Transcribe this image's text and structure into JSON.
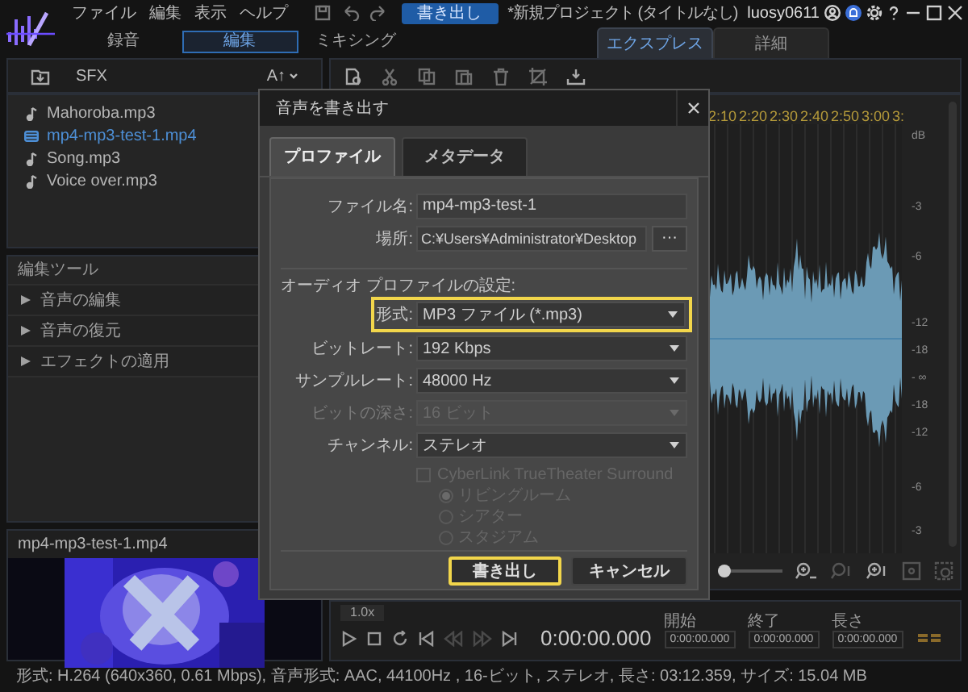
{
  "app": {
    "menu": [
      "ファイル",
      "編集",
      "表示",
      "ヘルプ"
    ],
    "export_button": "書き出し",
    "project_title": "*新規プロジェクト (タイトルなし)",
    "user": "luosy0611"
  },
  "mode_tabs": [
    {
      "label": "録音",
      "selected": false
    },
    {
      "label": "編集",
      "selected": true
    },
    {
      "label": "ミキシング",
      "selected": false
    }
  ],
  "view_tabs": [
    {
      "label": "エクスプレス",
      "selected": true
    },
    {
      "label": "詳細",
      "selected": false
    }
  ],
  "library": {
    "sfx_label": "SFX",
    "sort_label": "A↑",
    "files": [
      {
        "name": "Mahoroba.mp3",
        "kind": "audio",
        "selected": false
      },
      {
        "name": "mp4-mp3-test-1.mp4",
        "kind": "video",
        "selected": true
      },
      {
        "name": "Song.mp3",
        "kind": "audio",
        "selected": false
      },
      {
        "name": "Voice over.mp3",
        "kind": "audio",
        "selected": false
      }
    ]
  },
  "edit_tools": {
    "title": "編集ツール",
    "items": [
      {
        "label": "音声の編集",
        "expanded": false
      },
      {
        "label": "音声の復元",
        "expanded": false
      },
      {
        "label": "エフェクトの適用",
        "expanded": false
      }
    ]
  },
  "preview": {
    "title": "mp4-mp3-test-1.mp4",
    "kind": "picture"
  },
  "waveform": {
    "ruler": [
      "2:10",
      "2:20",
      "2:30",
      "2:40",
      "2:50",
      "3:00",
      "3:"
    ],
    "db_scale": [
      "dB",
      "-3",
      "-6",
      "-12",
      "-18",
      "- ∞",
      "-18",
      "-12",
      "-6",
      "-3"
    ],
    "zoom": {
      "level": 0
    }
  },
  "transport": {
    "speed": "1.0x",
    "time": "0:00:00.000",
    "fields": [
      {
        "label": "開始",
        "value": "0:00:00.000"
      },
      {
        "label": "終了",
        "value": "0:00:00.000"
      },
      {
        "label": "長さ",
        "value": "0:00:00.000"
      }
    ]
  },
  "status_bar": "形式: H.264 (640x360, 0.61 Mbps), 音声形式: AAC, 44100Hz , 16-ビット, ステレオ, 長さ: 03:12.359, サイズ: 15.04 MB",
  "dialog": {
    "title": "音声を書き出す",
    "tabs": [
      {
        "label": "プロファイル",
        "selected": true
      },
      {
        "label": "メタデータ",
        "selected": false
      }
    ],
    "file_name": {
      "label": "ファイル名:",
      "value": "mp4-mp3-test-1"
    },
    "location": {
      "label": "場所:",
      "value": "C:¥Users¥Administrator¥Desktop",
      "browse": "···"
    },
    "section_title": "オーディオ プロファイルの設定:",
    "selects": [
      {
        "label": "形式:",
        "value": "MP3 ファイル (*.mp3)",
        "disabled": false,
        "highlighted": true
      },
      {
        "label": "ビットレート:",
        "value": "192 Kbps",
        "disabled": false,
        "highlighted": false
      },
      {
        "label": "サンプルレート:",
        "value": "48000 Hz",
        "disabled": false,
        "highlighted": false
      },
      {
        "label": "ビットの深さ:",
        "value": "16 ビット",
        "disabled": true,
        "highlighted": false
      },
      {
        "label": "チャンネル:",
        "value": "ステレオ",
        "disabled": false,
        "highlighted": false
      }
    ],
    "surround": {
      "label": "CyberLink TrueTheater Surround",
      "checked": false,
      "disabled": true
    },
    "surround_modes": [
      {
        "label": "リビングルーム",
        "selected": true
      },
      {
        "label": "シアター",
        "selected": false
      },
      {
        "label": "スタジアム",
        "selected": false
      }
    ],
    "buttons": [
      {
        "label": "書き出し",
        "kind": "primary",
        "highlighted": true
      },
      {
        "label": "キャンセル",
        "kind": "secondary",
        "highlighted": false
      }
    ]
  }
}
